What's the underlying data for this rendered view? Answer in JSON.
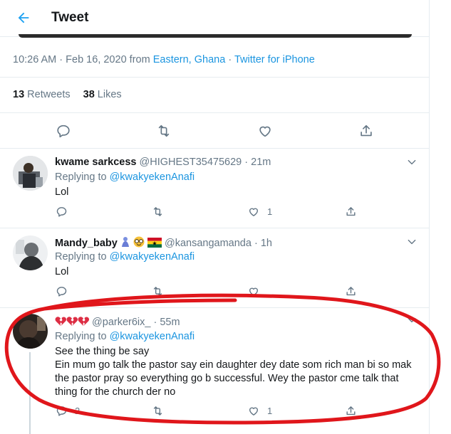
{
  "header": {
    "title": "Tweet"
  },
  "tweet_meta": {
    "time": "10:26 AM",
    "date": "Feb 16, 2020",
    "from_label": "from",
    "location": "Eastern, Ghana",
    "source": "Twitter for iPhone",
    "separator": "·"
  },
  "stats": {
    "retweets_count": "13",
    "retweets_label": "Retweets",
    "likes_count": "38",
    "likes_label": "Likes"
  },
  "replies": [
    {
      "display_name": "kwame sarkcess",
      "handle": "@HIGHEST35475629",
      "time": "21m",
      "replying_label": "Replying to",
      "replying_to": "@kwakyekenAnafi",
      "text": "Lol",
      "reply_count": "",
      "retweet_count": "",
      "like_count": "1"
    },
    {
      "display_name": "Mandy_baby",
      "handle": "@kansangamanda",
      "time": "1h",
      "replying_label": "Replying to",
      "replying_to": "@kwakyekenAnafi",
      "text": "Lol",
      "reply_count": "",
      "retweet_count": "",
      "like_count": ""
    },
    {
      "display_name": "",
      "handle": "@parker6ix_",
      "time": "55m",
      "replying_label": "Replying to",
      "replying_to": "@kwakyekenAnafi",
      "text_line1": "See the thing be say",
      "text_line2": "Ein mum go talk the pastor say ein daughter dey date som rich man bi so mak the pastor pray so everything go b successful. Wey the pastor cme talk that thing for the church der no",
      "reply_count": "2",
      "retweet_count": "",
      "like_count": "1"
    }
  ],
  "dot": "·",
  "icons": {
    "back": "arrow-left-icon",
    "reply": "reply-icon",
    "retweet": "retweet-icon",
    "like": "heart-icon",
    "share": "share-icon",
    "caret": "chevron-down-icon"
  },
  "colors": {
    "accent": "#1b95e0",
    "muted": "#657786",
    "text": "#14171a",
    "border": "#e6ecf0",
    "annotation": "#e0161b"
  }
}
